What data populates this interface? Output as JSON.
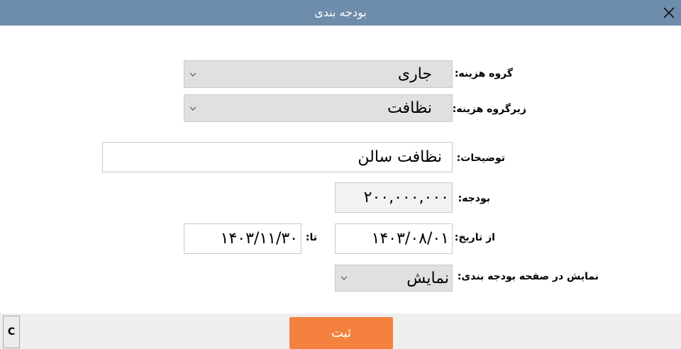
{
  "window": {
    "title": "بودجه بندی",
    "close_icon": "close-icon"
  },
  "form": {
    "expense_group": {
      "label": "گروه هزینه:",
      "value": "جاری"
    },
    "expense_subgroup": {
      "label": "زیرگروه هزینه:",
      "value": "نظافت"
    },
    "description": {
      "label": "توضیحات:",
      "value": "نظافت سالن"
    },
    "budget": {
      "label": "بودجه:",
      "value": "۲۰۰,۰۰۰,۰۰۰"
    },
    "from_date": {
      "label": "از تاریخ:",
      "value": "۱۴۰۳/۰۸/۰۱"
    },
    "to_date": {
      "label": "تا:",
      "value": "۱۴۰۳/۱۱/۳۰"
    },
    "show_in_budget_page": {
      "label": "نمایش در صفحه بودجه بندی:",
      "value": "نمایش"
    }
  },
  "footer": {
    "submit_label": "ثبت",
    "c_label": "C"
  },
  "colors": {
    "titlebar": "#6e8cab",
    "submit": "#f5813f",
    "select_bg": "#e0e0e0"
  }
}
